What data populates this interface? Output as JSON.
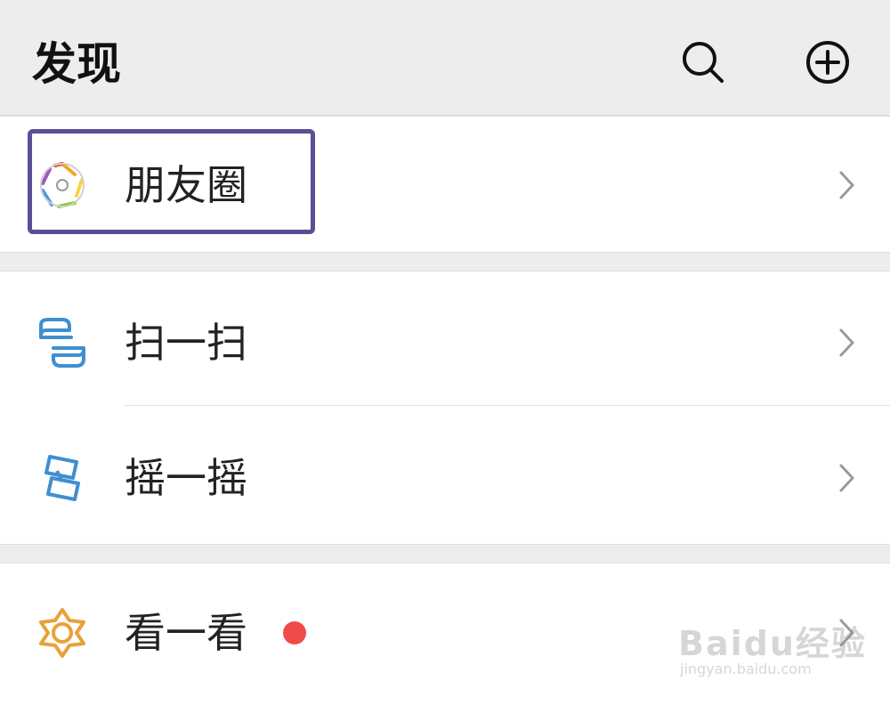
{
  "header": {
    "title": "发现",
    "icons": [
      "search-icon",
      "add-circle-icon"
    ]
  },
  "menu": {
    "moments": {
      "label": "朋友圈",
      "icon": "moments-aperture-icon"
    },
    "scan": {
      "label": "扫一扫",
      "icon": "scan-icon"
    },
    "shake": {
      "label": "摇一摇",
      "icon": "shake-icon"
    },
    "top_stories": {
      "label": "看一看",
      "icon": "top-stories-icon",
      "badge": "red-dot"
    }
  },
  "colors": {
    "background": "#ededed",
    "card": "#ffffff",
    "highlight_border": "#5a4f94",
    "badge": "#f04b4b",
    "blue_icon": "#3f8fd0",
    "orange_icon": "#e8a23a"
  },
  "watermark": {
    "logo": "Baidu经验",
    "url": "jingyan.baidu.com"
  }
}
